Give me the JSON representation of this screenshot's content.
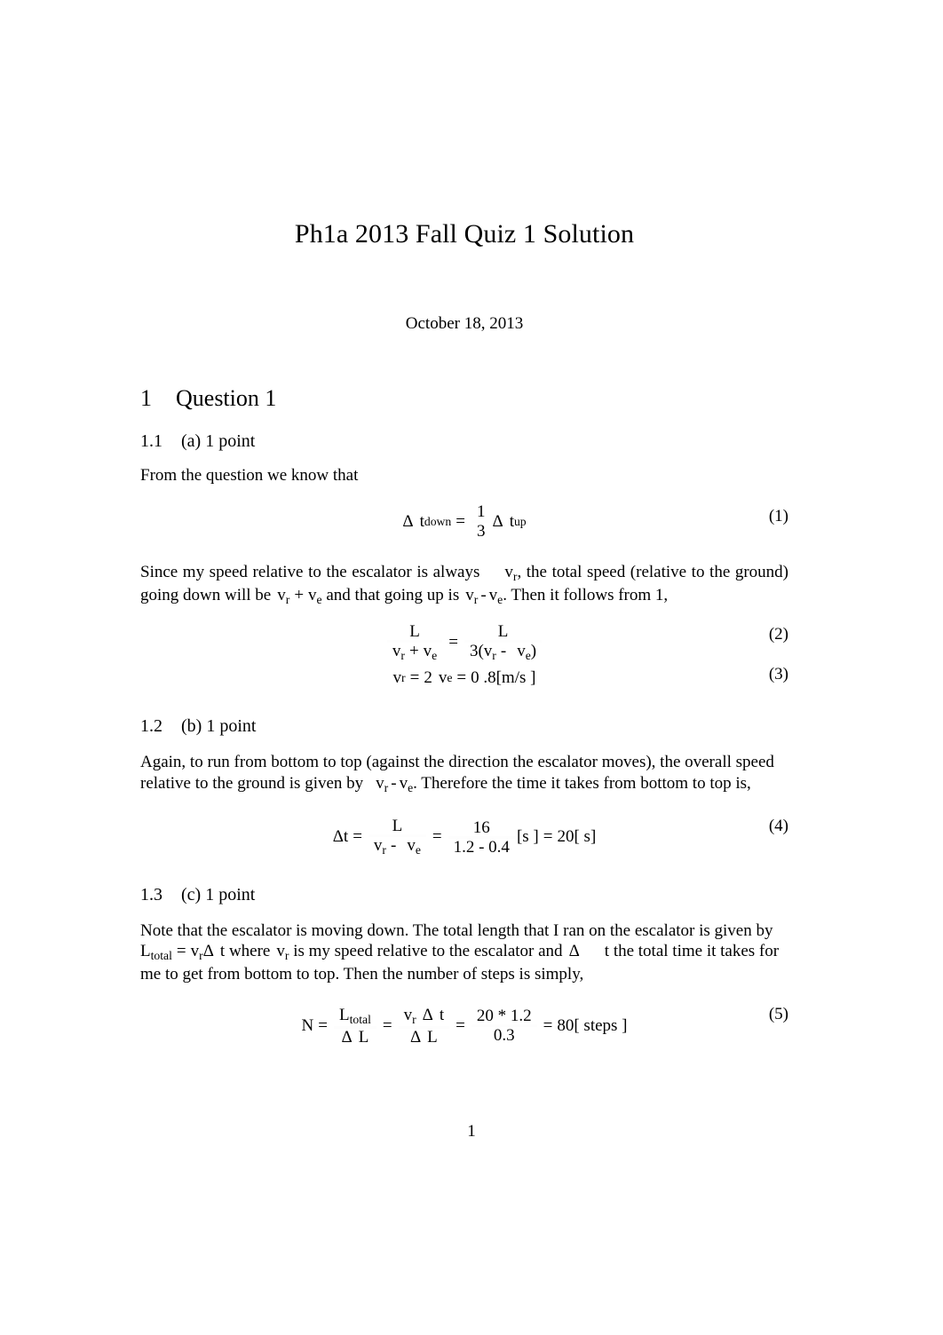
{
  "document": {
    "title": "Ph1a 2013 Fall Quiz 1 Solution",
    "date": "October 18, 2013",
    "page_number": "1"
  },
  "section1": {
    "number": "1",
    "title": "Question 1"
  },
  "sub_1_1": {
    "number": "1.1",
    "title": "(a) 1 point",
    "para1": "From the question we know that",
    "para2_a": "Since my speed relative to the escalator is always",
    "para2_v": "v",
    "para2_vsub": "r",
    "para2_b": ", the total speed (relative to the",
    "para2_c": "ground) going down will be",
    "para2_vr": "v",
    "para2_vrsub": "r",
    "para2_plus": "+",
    "para2_ve": "v",
    "para2_vesub": "e",
    "para2_d": "and that going up is",
    "para2_e": ". Then it follows from 1,"
  },
  "eq1": {
    "number": "(1)",
    "lhs_delta": "Δ",
    "lhs_t": "t",
    "lhs_sub": "down",
    "equals": "=",
    "frac_num": "1",
    "frac_den": "3",
    "rhs_delta": "Δ",
    "rhs_t": "t",
    "rhs_sub": "up"
  },
  "eq2": {
    "number": "(2)",
    "left_num": "L",
    "left_den_v": "v",
    "left_den_vsub": "r",
    "left_den_plus": "+",
    "left_den_e": "v",
    "left_den_esub": "e",
    "equals": "=",
    "right_num": "L",
    "right_den_pre": "3(",
    "right_den_v": "v",
    "right_den_vsub": "r",
    "right_den_minus": "-",
    "right_den_e": "v",
    "right_den_esub": "e",
    "right_den_post": ")"
  },
  "eq3": {
    "number": "(3)",
    "v": "v",
    "vsub": "r",
    "eq_a": "=",
    "two": "2",
    "ve": "v",
    "vesub": "e",
    "eq_b": "=",
    "value": "0 .8[m/s  ]"
  },
  "sub_1_2": {
    "number": "1.2",
    "title": "(b) 1 point",
    "para_a": "Again, to run from bottom to top (against the direction the escalator moves), the overall",
    "para_b": "speed relative to the ground is given by",
    "para_vr": "v",
    "para_vrsub": "r",
    "para_minus": "-",
    "para_ve": "v",
    "para_vesub": "e",
    "para_c": ". Therefore the time it takes from bottom",
    "para_d": "to top is,"
  },
  "eq4": {
    "number": "(4)",
    "delta": "Δ",
    "t": "t",
    "equals1": "=",
    "left_num": "L",
    "left_den_v": "v",
    "left_den_vsub": "r",
    "left_den_minus": "-",
    "left_den_e": "v",
    "left_den_esub": "e",
    "equals2": "=",
    "right_num": "16",
    "right_den": "1.2 -   0.4",
    "units": "[s ]",
    "equals3": "=",
    "result": "20[ s]"
  },
  "sub_1_3": {
    "number": "1.3",
    "title": "(c) 1 point",
    "para_a": "Note that the escalator is moving down. The total length that I ran on the escalator is",
    "para_b": "given by",
    "para_L": "L",
    "para_Lsub": "total",
    "para_eq": "=",
    "para_vr": "v",
    "para_vrsub": "r",
    "para_delta": "Δ",
    "para_t": "t",
    "para_c": "where",
    "para_vr2": "v",
    "para_vr2sub": "r",
    "para_d": "is my speed relative to the escalator and",
    "para_delta2": "Δ",
    "para_t2": "t",
    "para_e": "the total",
    "para_f": "time it takes for me to get from bottom to top. Then the number of steps is simply,"
  },
  "eq5": {
    "number": "(5)",
    "N": "N",
    "equals1": "=",
    "f1_num_L": "L",
    "f1_num_sub": "total",
    "f1_den_delta": "Δ",
    "f1_den_L": "L",
    "equals2": "=",
    "f2_num_v": "v",
    "f2_num_vsub": "r",
    "f2_num_delta": "Δ",
    "f2_num_t": "t",
    "f2_den_delta": "Δ",
    "f2_den_L": "L",
    "equals3": "=",
    "f3_num": "20 * 1.2",
    "f3_den": "0.3",
    "equals4": "=",
    "result": "80[ steps  ]"
  }
}
